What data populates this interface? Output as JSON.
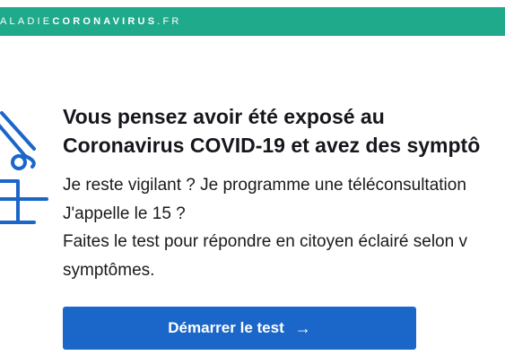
{
  "header": {
    "brand_prefix": "ALADIE",
    "brand_strong": "CORONAVIRUS",
    "brand_suffix": ".FR"
  },
  "main": {
    "title_line1": "Vous pensez avoir été exposé au",
    "title_line2": "Coronavirus COVID-19 et avez des symptô",
    "body_lines": [
      "Je reste vigilant ? Je programme une téléconsultation",
      "J'appelle le 15 ?",
      "Faites le test pour répondre en citoyen éclairé selon v",
      "symptômes."
    ],
    "cta_label": "Démarrer le test",
    "cta_arrow": "→"
  },
  "colors": {
    "header_green": "#1faa8b",
    "accent_blue": "#1a66c9"
  },
  "icons": {
    "illustration": "thermometer-person-icon",
    "cta_arrow": "arrow-right-icon"
  }
}
